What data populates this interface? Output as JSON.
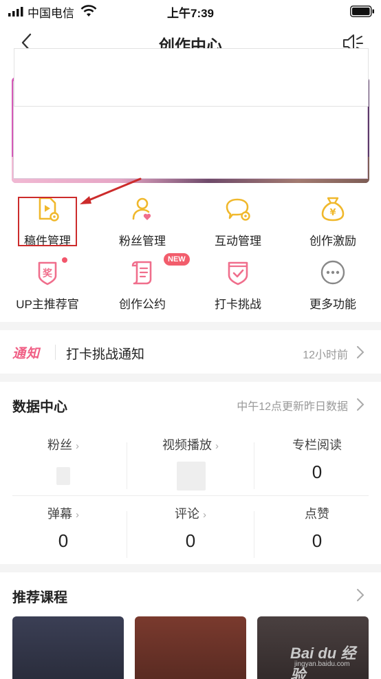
{
  "status_bar": {
    "carrier": "中国电信",
    "time": "上午7:39"
  },
  "nav": {
    "title": "创作中心"
  },
  "grid": {
    "items": [
      {
        "label": "稿件管理"
      },
      {
        "label": "粉丝管理"
      },
      {
        "label": "互动管理"
      },
      {
        "label": "创作激励"
      },
      {
        "label": "UP主推荐官"
      },
      {
        "label": "创作公约",
        "badge": "NEW"
      },
      {
        "label": "打卡挑战"
      },
      {
        "label": "更多功能"
      }
    ],
    "icon_glyphs": {
      "reward": "奖",
      "money": "¥"
    }
  },
  "notice": {
    "tag": "通知",
    "text": "打卡挑战通知",
    "time": "12小时前"
  },
  "data_center": {
    "heading": "数据中心",
    "hint": "中午12点更新昨日数据",
    "stats": [
      {
        "name": "粉丝",
        "value": ""
      },
      {
        "name": "视频播放",
        "value": ""
      },
      {
        "name": "专栏阅读",
        "value": "0"
      },
      {
        "name": "弹幕",
        "value": "0"
      },
      {
        "name": "评论",
        "value": "0"
      },
      {
        "name": "点赞",
        "value": "0"
      }
    ]
  },
  "courses": {
    "heading": "推荐课程"
  },
  "watermark": {
    "brand": "Bai du 经验",
    "url": "jingyan.baidu.com"
  },
  "colors": {
    "accent_yellow": "#f0b82c",
    "accent_pink": "#f06e8c",
    "highlight_red": "#cc2b2b",
    "muted": "#999999"
  }
}
